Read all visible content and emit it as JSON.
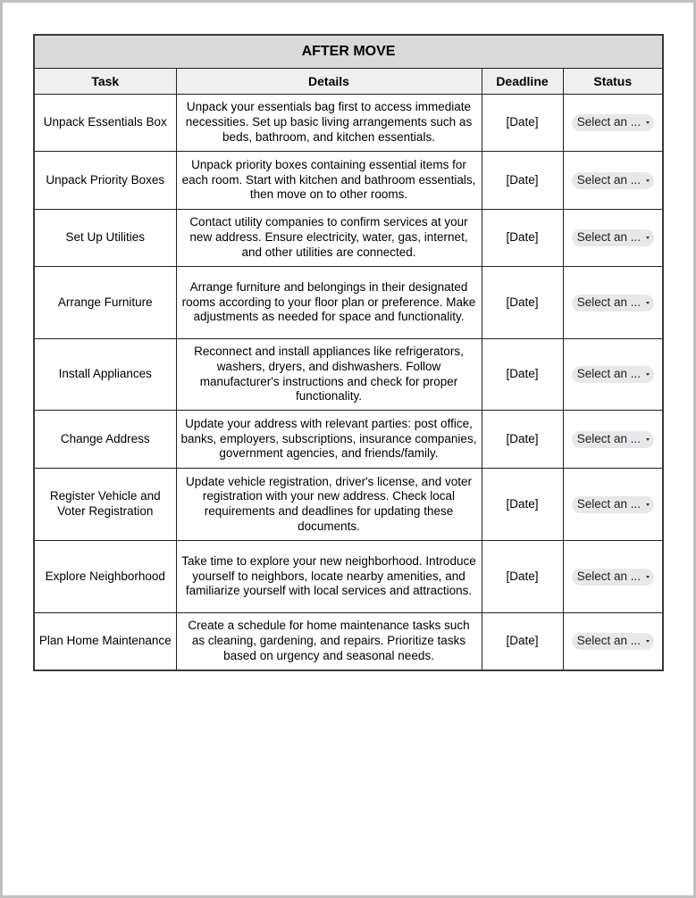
{
  "table": {
    "title": "AFTER MOVE",
    "headers": {
      "task": "Task",
      "details": "Details",
      "deadline": "Deadline",
      "status": "Status"
    },
    "rows": [
      {
        "task": "Unpack Essentials Box",
        "details": "Unpack your essentials bag first to access immediate necessities. Set up basic living arrangements such as beds, bathroom, and kitchen essentials.",
        "deadline": "[Date]",
        "status": "Select an ..."
      },
      {
        "task": "Unpack Priority Boxes",
        "details": "Unpack priority boxes containing essential items for each room. Start with kitchen and bathroom essentials, then move on to other rooms.",
        "deadline": "[Date]",
        "status": "Select an ..."
      },
      {
        "task": "Set Up Utilities",
        "details": "Contact utility companies to confirm services at your new address. Ensure electricity, water, gas, internet, and other utilities are connected.",
        "deadline": "[Date]",
        "status": "Select an ..."
      },
      {
        "task": "Arrange Furniture",
        "details": "Arrange furniture and belongings in their designated rooms according to your floor plan or preference. Make adjustments as needed for space and functionality.",
        "deadline": "[Date]",
        "status": "Select an ..."
      },
      {
        "task": "Install Appliances",
        "details": "Reconnect and install appliances like refrigerators, washers, dryers, and dishwashers. Follow manufacturer's instructions and check for proper functionality.",
        "deadline": "[Date]",
        "status": "Select an ..."
      },
      {
        "task": "Change Address",
        "details": "Update your address with relevant parties: post office, banks, employers, subscriptions, insurance companies, government agencies, and friends/family.",
        "deadline": "[Date]",
        "status": "Select an ..."
      },
      {
        "task": "Register Vehicle and Voter Registration",
        "details": "Update vehicle registration, driver's license, and voter registration with your new address. Check local requirements and deadlines for updating these documents.",
        "deadline": "[Date]",
        "status": "Select an ..."
      },
      {
        "task": "Explore Neighborhood",
        "details": "Take time to explore your new neighborhood. Introduce yourself to neighbors, locate nearby amenities, and familiarize yourself with local services and attractions.",
        "deadline": "[Date]",
        "status": "Select an ..."
      },
      {
        "task": "Plan Home Maintenance",
        "details": "Create a schedule for home maintenance tasks such as cleaning, gardening, and repairs. Prioritize tasks based on urgency and seasonal needs.",
        "deadline": "[Date]",
        "status": "Select an ..."
      }
    ]
  }
}
